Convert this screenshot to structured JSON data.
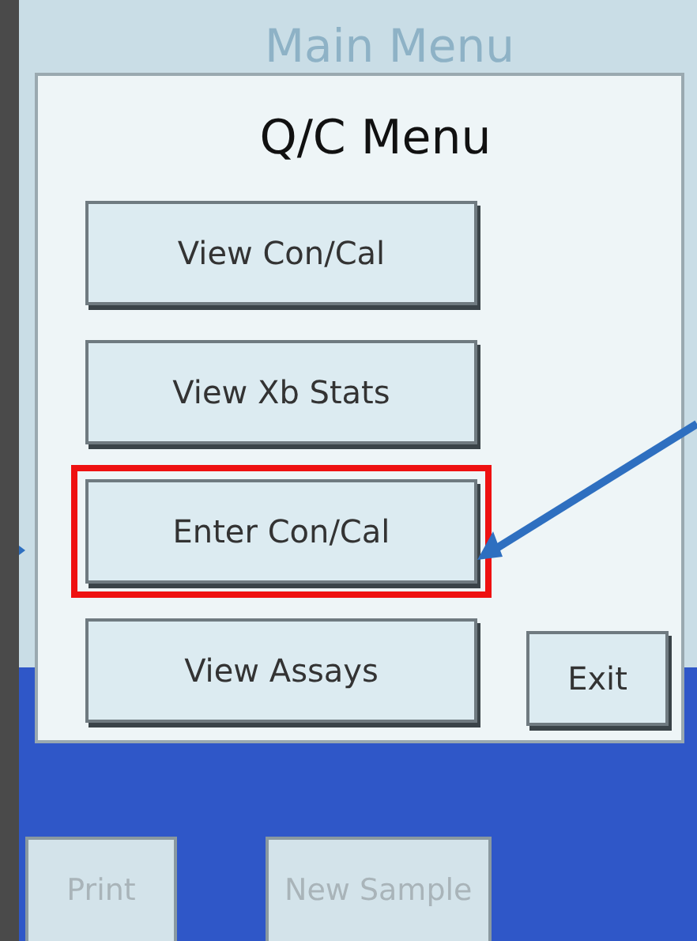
{
  "title": "Main Menu",
  "menu": {
    "heading": "Q/C Menu",
    "buttons": [
      {
        "label": "View Con/Cal",
        "highlighted": false
      },
      {
        "label": "View Xb Stats",
        "highlighted": false
      },
      {
        "label": "Enter Con/Cal",
        "highlighted": true
      },
      {
        "label": "View Assays",
        "highlighted": false
      }
    ],
    "exit": "Exit"
  },
  "bottom_tabs": [
    {
      "label": "Print",
      "disabled": true
    },
    {
      "label": "New Sample",
      "disabled": true
    }
  ]
}
